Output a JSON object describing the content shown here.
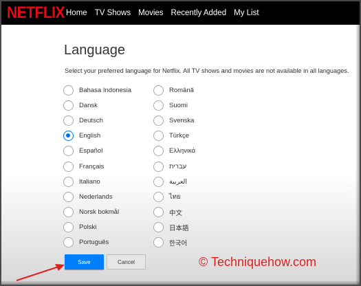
{
  "header": {
    "logo": "NETFLIX",
    "nav": [
      "Home",
      "TV Shows",
      "Movies",
      "Recently Added",
      "My List"
    ]
  },
  "page": {
    "title": "Language",
    "subtitle": "Select your preferred language for Netflix. All TV shows and movies are not available in all languages."
  },
  "languages_left": [
    {
      "label": "Bahasa Indonesia",
      "checked": false
    },
    {
      "label": "Dansk",
      "checked": false
    },
    {
      "label": "Deutsch",
      "checked": false
    },
    {
      "label": "English",
      "checked": true
    },
    {
      "label": "Español",
      "checked": false
    },
    {
      "label": "Français",
      "checked": false
    },
    {
      "label": "Italiano",
      "checked": false
    },
    {
      "label": "Nederlands",
      "checked": false
    },
    {
      "label": "Norsk bokmål",
      "checked": false
    },
    {
      "label": "Polski",
      "checked": false
    },
    {
      "label": "Português",
      "checked": false
    }
  ],
  "languages_right": [
    {
      "label": "Română",
      "checked": false
    },
    {
      "label": "Suomi",
      "checked": false
    },
    {
      "label": "Svenska",
      "checked": false
    },
    {
      "label": "Türkçe",
      "checked": false
    },
    {
      "label": "Ελληνικά",
      "checked": false
    },
    {
      "label": "עברית",
      "checked": false
    },
    {
      "label": "العربية",
      "checked": false
    },
    {
      "label": "ไทย",
      "checked": false
    },
    {
      "label": "中文",
      "checked": false
    },
    {
      "label": "日本語",
      "checked": false
    },
    {
      "label": "한국어",
      "checked": false
    }
  ],
  "buttons": {
    "save": "Save",
    "cancel": "Cancel"
  },
  "watermark": "© Techniquehow.com",
  "colors": {
    "brand": "#e50914",
    "accent": "#0080ff",
    "annotation": "#e0201e"
  }
}
